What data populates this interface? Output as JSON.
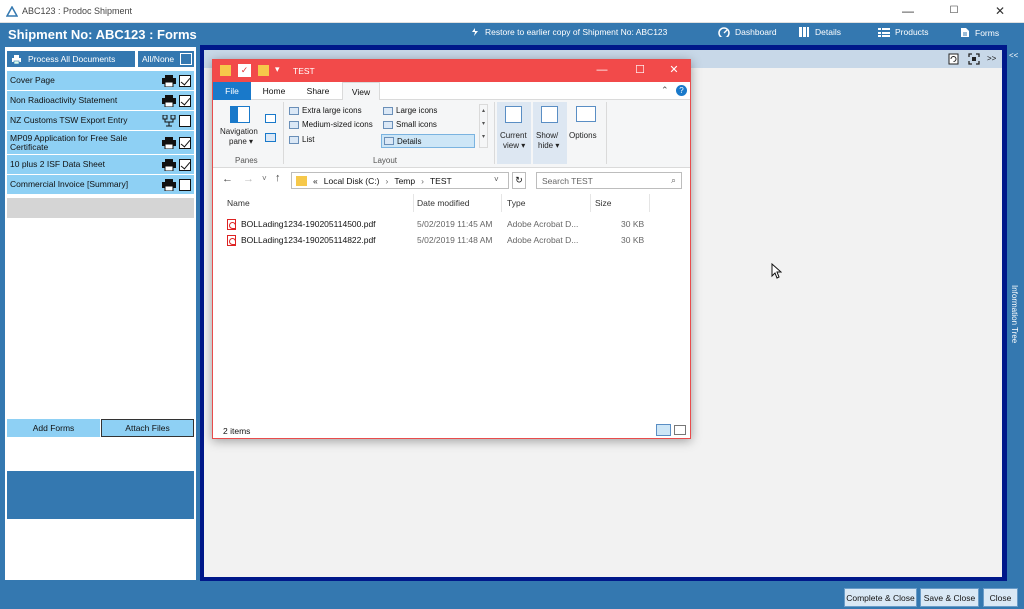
{
  "window": {
    "title": "ABC123 : Prodoc Shipment",
    "min": "—",
    "max": "☐",
    "close": "✕"
  },
  "header": {
    "title": "Shipment No: ABC123 : Forms",
    "restore": "Restore to earlier copy of Shipment No: ABC123",
    "nav": [
      "Dashboard",
      "Details",
      "Products",
      "Forms"
    ]
  },
  "left": {
    "process_all": "Process All Documents",
    "all_none": "All/None",
    "documents": [
      {
        "label": "Cover Page",
        "icon": "printer",
        "checked": true
      },
      {
        "label": "Non Radioactivity Statement",
        "icon": "printer",
        "checked": true
      },
      {
        "label": "NZ Customs TSW Export Entry",
        "icon": "network",
        "checked": false
      },
      {
        "label": "MP09 Application for Free Sale Certificate",
        "icon": "printer",
        "checked": true
      },
      {
        "label": "10 plus 2 ISF Data Sheet",
        "icon": "printer",
        "checked": true
      },
      {
        "label": "Commercial Invoice [Summary]",
        "icon": "printer",
        "checked": false
      }
    ],
    "add_forms": "Add Forms",
    "attach_files": "Attach Files"
  },
  "toolstrip": {
    "collapse": ">>",
    "side_collapse": "<<"
  },
  "side_panel": {
    "label": "Information Tree"
  },
  "bottom": {
    "complete": "Complete & Close",
    "save": "Save & Close",
    "close": "Close"
  },
  "explorer": {
    "title": "TEST",
    "tabs": [
      "File",
      "Home",
      "Share",
      "View"
    ],
    "ribbon": {
      "nav_pane": "Navigation",
      "nav_pane2": "pane",
      "panes_group": "Panes",
      "layout_group": "Layout",
      "layouts": [
        "Extra large icons",
        "Large icons",
        "Medium-sized icons",
        "Small icons",
        "List",
        "Details"
      ],
      "current_view": "Current",
      "current_view2": "view",
      "show_hide": "Show/",
      "show_hide2": "hide",
      "options": "Options"
    },
    "address": {
      "prefix": "«",
      "path": [
        "Local Disk (C:)",
        "Temp",
        "TEST"
      ]
    },
    "search_placeholder": "Search TEST",
    "columns": [
      "Name",
      "Date modified",
      "Type",
      "Size"
    ],
    "files": [
      {
        "name": "BOLLading1234-190205114500.pdf",
        "date": "5/02/2019 11:45 AM",
        "type": "Adobe Acrobat D...",
        "size": "30 KB"
      },
      {
        "name": "BOLLading1234-190205114822.pdf",
        "date": "5/02/2019 11:48 AM",
        "type": "Adobe Acrobat D...",
        "size": "30 KB"
      }
    ],
    "status": "2 items"
  },
  "colors": {
    "brand_blue": "#3478b0",
    "doc_row": "#8ed0f4",
    "explorer_title": "#f24a4a",
    "frame_dark": "#00188a"
  }
}
